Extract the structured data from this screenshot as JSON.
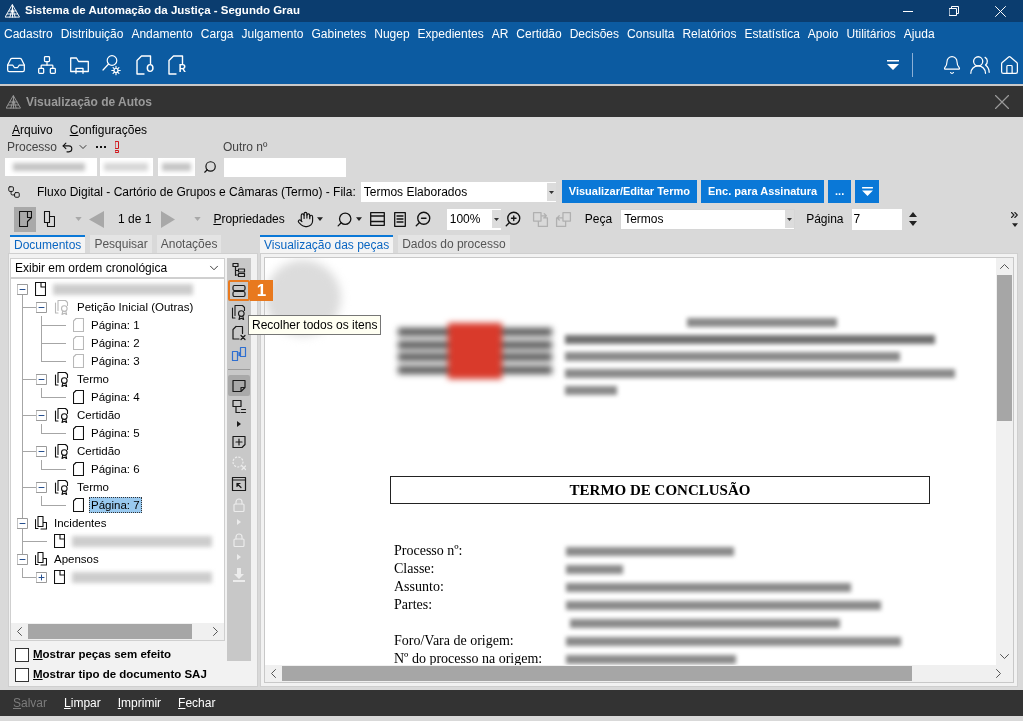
{
  "window": {
    "title": "Sistema de Automação da Justiça - Segundo Grau"
  },
  "menu_bar": [
    "Cadastro",
    "Distribuição",
    "Andamento",
    "Carga",
    "Julgamento",
    "Gabinetes",
    "Nugep",
    "Expedientes",
    "AR",
    "Certidão",
    "Decisões",
    "Consulta",
    "Relatórios",
    "Estatística",
    "Apoio",
    "Utilitários",
    "Ajuda"
  ],
  "toolbar": {
    "document_letters": [
      "O",
      "R"
    ]
  },
  "subwindow": {
    "title": "Visualização de Autos"
  },
  "subwindow_menu": [
    "Arquivo",
    "Configurações"
  ],
  "process": {
    "label": "Processo",
    "other_label": "Outro nº"
  },
  "flow": {
    "text": "Fluxo Digital - Cartório de Grupos e Câmaras (Termo) - Fila:",
    "queue": "Termos Elaborados",
    "buttons": [
      "Visualizar/Editar Termo",
      "Enc. para Assinatura",
      "..."
    ]
  },
  "viewer_toolbar": {
    "view_modes": [
      {
        "kind": "single",
        "selected": true
      },
      {
        "kind": "double",
        "selected": false
      }
    ],
    "pager": {
      "text": "1 de 1",
      "disabled": true
    },
    "properties": "Propriedades",
    "zoom": "100%",
    "copy_tools": [
      {
        "kind": "copy-in",
        "disabled": true
      },
      {
        "kind": "copy-out",
        "disabled": true
      }
    ],
    "piece_label": "Peça",
    "piece": "Termos",
    "page_label": "Página",
    "page": "7"
  },
  "left_tabs": [
    {
      "label": "Documentos",
      "selected": true
    },
    {
      "label": "Pesquisar",
      "selected": false
    },
    {
      "label": "Anotações",
      "selected": false
    }
  ],
  "order": "Exibir em ordem cronológica",
  "tree": [
    {
      "kind": "process",
      "redacted": true,
      "expanded": true,
      "selected": false,
      "children": [
        {
          "kind": "group",
          "label": "Petição Inicial (Outras)",
          "dimmed": true,
          "expanded": true,
          "selected": false,
          "children": [
            {
              "kind": "page",
              "label": "Página: 1",
              "dimmed": true,
              "selected": false
            },
            {
              "kind": "page",
              "label": "Página: 2",
              "dimmed": true,
              "selected": false
            },
            {
              "kind": "page",
              "label": "Página: 3",
              "dimmed": true,
              "selected": false
            }
          ]
        },
        {
          "kind": "group",
          "label": "Termo",
          "dimmed": false,
          "expanded": true,
          "selected": false,
          "children": [
            {
              "kind": "page",
              "label": "Página: 4",
              "dimmed": false,
              "selected": false
            }
          ]
        },
        {
          "kind": "group",
          "label": "Certidão",
          "dimmed": false,
          "expanded": true,
          "selected": false,
          "children": [
            {
              "kind": "page",
              "label": "Página: 5",
              "dimmed": false,
              "selected": false
            }
          ]
        },
        {
          "kind": "group",
          "label": "Certidão",
          "dimmed": false,
          "expanded": true,
          "selected": false,
          "children": [
            {
              "kind": "page",
              "label": "Página: 6",
              "dimmed": false,
              "selected": false
            }
          ]
        },
        {
          "kind": "group",
          "label": "Termo",
          "dimmed": false,
          "expanded": true,
          "selected": false,
          "children": [
            {
              "kind": "page",
              "label": "Página: 7",
              "dimmed": false,
              "selected": true
            }
          ]
        }
      ]
    },
    {
      "kind": "folder",
      "label": "Incidentes",
      "expanded": true,
      "selected": false,
      "children": [
        {
          "kind": "process",
          "redacted": true,
          "selected": false
        }
      ]
    },
    {
      "kind": "folder",
      "label": "Apensos",
      "expanded": true,
      "selected": false,
      "children": [
        {
          "kind": "process",
          "redacted": true,
          "expanded": false,
          "selected": false
        }
      ]
    }
  ],
  "side_tools": [
    {
      "kind": "expand-tree",
      "pressed": false,
      "disabled": false
    },
    {
      "kind": "collapse-tree",
      "pressed": false,
      "disabled": false,
      "highlighted": true,
      "callout": "1"
    },
    {
      "kind": "certificate-search",
      "pressed": false,
      "disabled": false
    },
    {
      "kind": "document-remove",
      "pressed": false,
      "disabled": false
    },
    {
      "kind": "documents-compare",
      "pressed": false,
      "disabled": false
    },
    {
      "kind": "separator"
    },
    {
      "kind": "note",
      "pressed": true,
      "disabled": false
    },
    {
      "kind": "note-list",
      "pressed": false,
      "disabled": false,
      "menu": true
    },
    {
      "kind": "note-add",
      "pressed": false,
      "disabled": false
    },
    {
      "kind": "dotted-remove",
      "pressed": false,
      "disabled": true
    },
    {
      "kind": "window-pointer",
      "pressed": false,
      "disabled": false
    },
    {
      "kind": "lock",
      "pressed": false,
      "disabled": true,
      "menu": true
    },
    {
      "kind": "lock",
      "pressed": false,
      "disabled": true,
      "menu": true
    },
    {
      "kind": "download",
      "pressed": false,
      "disabled": true
    }
  ],
  "tooltip": "Recolher todos os itens",
  "options": [
    {
      "label": "Mostrar peças sem efeito",
      "checked": false
    },
    {
      "label": "Mostrar tipo de documento SAJ",
      "checked": false
    }
  ],
  "viewer_tabs": [
    {
      "label": "Visualização das peças",
      "selected": true
    },
    {
      "label": "Dados do processo",
      "selected": false
    }
  ],
  "document": {
    "title": "TERMO DE CONCLUSÃO",
    "fields": [
      {
        "label": "Processo nº:",
        "kind": "single"
      },
      {
        "label": "Classe:",
        "kind": "single"
      },
      {
        "label": "Assunto:",
        "kind": "single"
      },
      {
        "label": "Partes:",
        "kind": "double"
      },
      {
        "label": "Foro/Vara de origem:",
        "kind": "single"
      },
      {
        "label": "Nº do processo na origem:",
        "kind": "single"
      }
    ]
  },
  "actions": [
    {
      "label": "Salvar",
      "disabled": true
    },
    {
      "label": "Limpar",
      "disabled": false
    },
    {
      "label": "Imprimir",
      "disabled": false
    },
    {
      "label": "Fechar",
      "disabled": false
    }
  ]
}
